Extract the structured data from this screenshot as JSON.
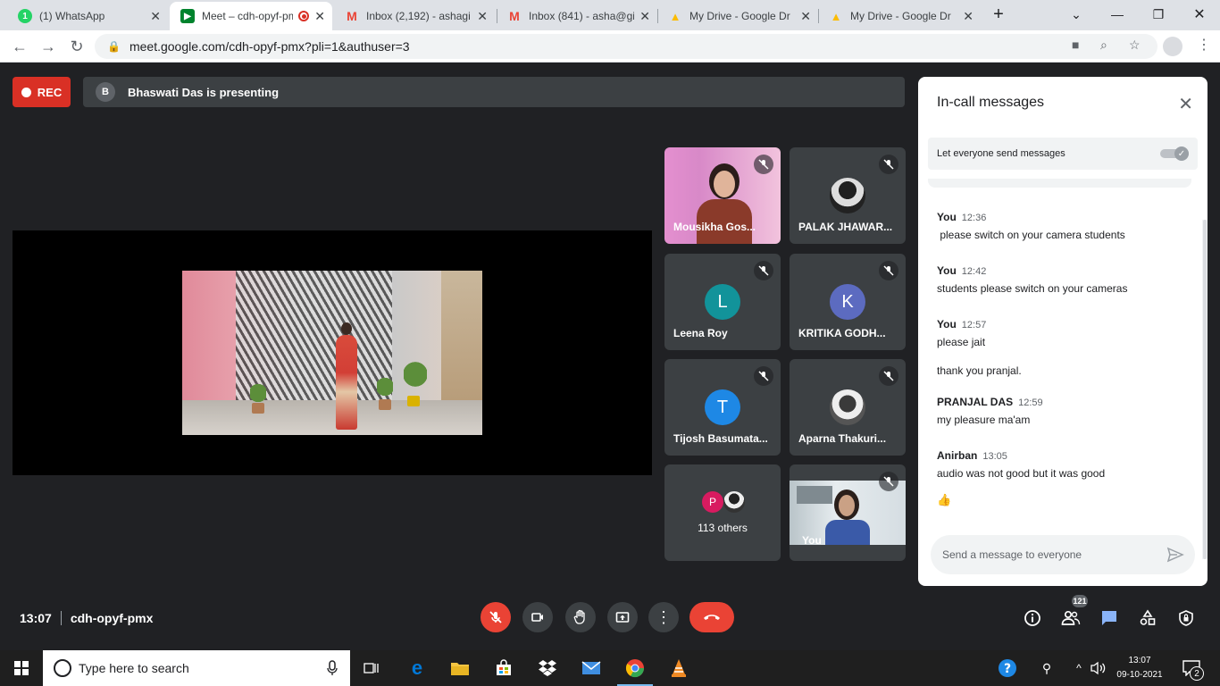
{
  "browser": {
    "tabs": [
      {
        "title": "(1) WhatsApp",
        "favicon": "whatsapp-icon",
        "color": "#25d366",
        "glyph": "1"
      },
      {
        "title": "Meet – cdh-opyf-pmx",
        "favicon": "google-meet-icon",
        "color": "#00832d",
        "glyph": "▶"
      },
      {
        "title": "Inbox (2,192) - ashagi",
        "favicon": "gmail-icon",
        "color": "#ea4335",
        "glyph": "M"
      },
      {
        "title": "Inbox (841) - asha@gi",
        "favicon": "gmail-icon",
        "color": "#ea4335",
        "glyph": "M"
      },
      {
        "title": "My Drive - Google Dr",
        "favicon": "google-drive-icon",
        "color": "#fbbc04",
        "glyph": "▲"
      },
      {
        "title": "My Drive - Google Dr",
        "favicon": "google-drive-icon",
        "color": "#fbbc04",
        "glyph": "▲"
      }
    ],
    "new_tab": "+",
    "url": "meet.google.com/cdh-opyf-pmx?pli=1&authuser=3"
  },
  "meet": {
    "rec_label": "REC",
    "presenter_initial": "B",
    "presenting_text": "Bhaswati Das is presenting",
    "participants": [
      {
        "name": "Mousikha Gos...",
        "type": "video"
      },
      {
        "name": "PALAK JHAWAR...",
        "type": "photo"
      },
      {
        "name": "Leena Roy",
        "type": "initial",
        "initial": "L",
        "color": "#12939a"
      },
      {
        "name": "KRITIKA GODH...",
        "type": "initial",
        "initial": "K",
        "color": "#5c6bc0"
      },
      {
        "name": "Tijosh Basumata...",
        "type": "initial",
        "initial": "T",
        "color": "#1e88e5"
      },
      {
        "name": "Aparna Thakuri...",
        "type": "photo"
      },
      {
        "name": "113 others",
        "type": "others",
        "initial": "P",
        "color": "#d81b60"
      },
      {
        "name": "You",
        "type": "self"
      }
    ],
    "panel": {
      "title": "In-call messages",
      "toggle_label": "Let everyone send messages",
      "messages": [
        {
          "sender": "You",
          "time": "12:36",
          "text": " please switch on your camera students"
        },
        {
          "sender": "You",
          "time": "12:42",
          "text": "students please switch on your cameras"
        },
        {
          "sender": "You",
          "time": "12:57",
          "text": "please jait"
        },
        {
          "sender": "",
          "time": "",
          "text": "thank you pranjal."
        },
        {
          "sender": "PRANJAL DAS",
          "time": "12:59",
          "text": "my pleasure ma'am"
        },
        {
          "sender": "Anirban",
          "time": "13:05",
          "text": "audio was not good but it was good"
        },
        {
          "sender": "",
          "time": "",
          "text": "👍"
        }
      ],
      "input_placeholder": "Send a message to everyone"
    },
    "bottom": {
      "time": "13:07",
      "meeting_code": "cdh-opyf-pmx",
      "participant_count": "121"
    }
  },
  "taskbar": {
    "search_placeholder": "Type here to search",
    "clock_time": "13:07",
    "clock_date": "09-10-2021",
    "notification_count": "2"
  }
}
